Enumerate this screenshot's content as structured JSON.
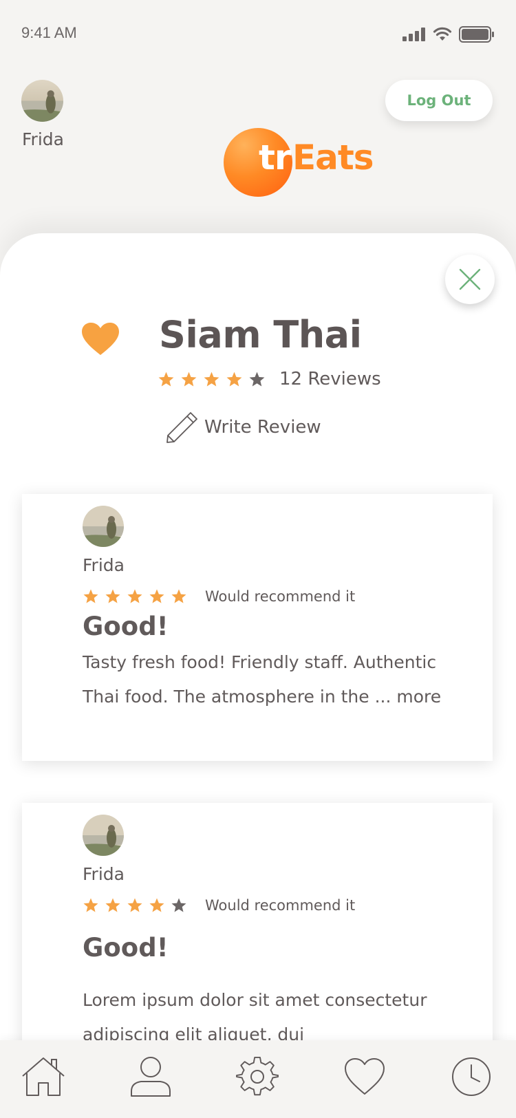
{
  "status_bar": {
    "time": "9:41 AM"
  },
  "header": {
    "username": "Frida",
    "logout_label": "Log Out",
    "logo": {
      "part1": "tr",
      "part2": "Eats"
    }
  },
  "restaurant": {
    "name": "Siam Thai",
    "rating": 4,
    "rating_max": 5,
    "reviews_count": "12 Reviews",
    "write_review_label": "Write Review",
    "favorited": true
  },
  "reviews": [
    {
      "user": "Frida",
      "rating": 5,
      "recommend": "Would recommend it",
      "title": "Good!",
      "body": "Tasty fresh food! Friendly staff. Authentic Thai food. The atmosphere in the ... more"
    },
    {
      "user": "Frida",
      "rating": 4,
      "recommend": "Would recommend it",
      "title": "Good!",
      "body": "Lorem ipsum dolor sit amet consectetur adipiscing elit aliquet, dui"
    }
  ],
  "tabbar": {
    "icons": [
      "home-icon",
      "profile-icon",
      "settings-icon",
      "favorites-icon",
      "history-icon"
    ]
  },
  "colors": {
    "accent": "#ff8a25",
    "star": "#f5a244",
    "star_empty": "#6b6666",
    "logout_text": "#6cb27a",
    "text": "#605a5a",
    "background": "#f5f4f2"
  }
}
